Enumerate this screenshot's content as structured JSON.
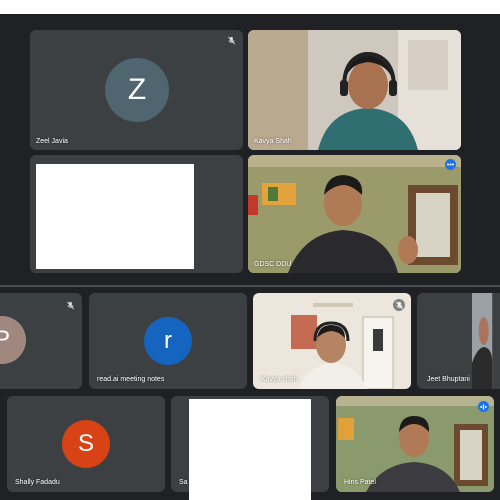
{
  "participants": {
    "zeel": {
      "name": "Zeel Javia",
      "initial": "Z",
      "avatar_color": "#4f6570"
    },
    "kavya_top": {
      "name": "Kavya Shah"
    },
    "gdsc": {
      "name": "GDSC DDU"
    },
    "p": {
      "initial": "P",
      "avatar_color": "#a1887f"
    },
    "readai": {
      "name": "read.ai meeting notes",
      "initial": "r",
      "avatar_color": "#1565c0"
    },
    "kavya": {
      "name": "Kavya shah"
    },
    "jeet": {
      "name": "Jeet Bhuptani"
    },
    "shally": {
      "name": "Shally Fadadu",
      "initial": "S",
      "avatar_color": "#d84315"
    },
    "sa": {
      "name": "Sa"
    },
    "hiris": {
      "name": "Hiris Patel"
    }
  },
  "colors": {
    "background": "#202124",
    "tile": "#3c4043",
    "active_border": "#8ab4f8",
    "speaking": "#1a73e8"
  }
}
